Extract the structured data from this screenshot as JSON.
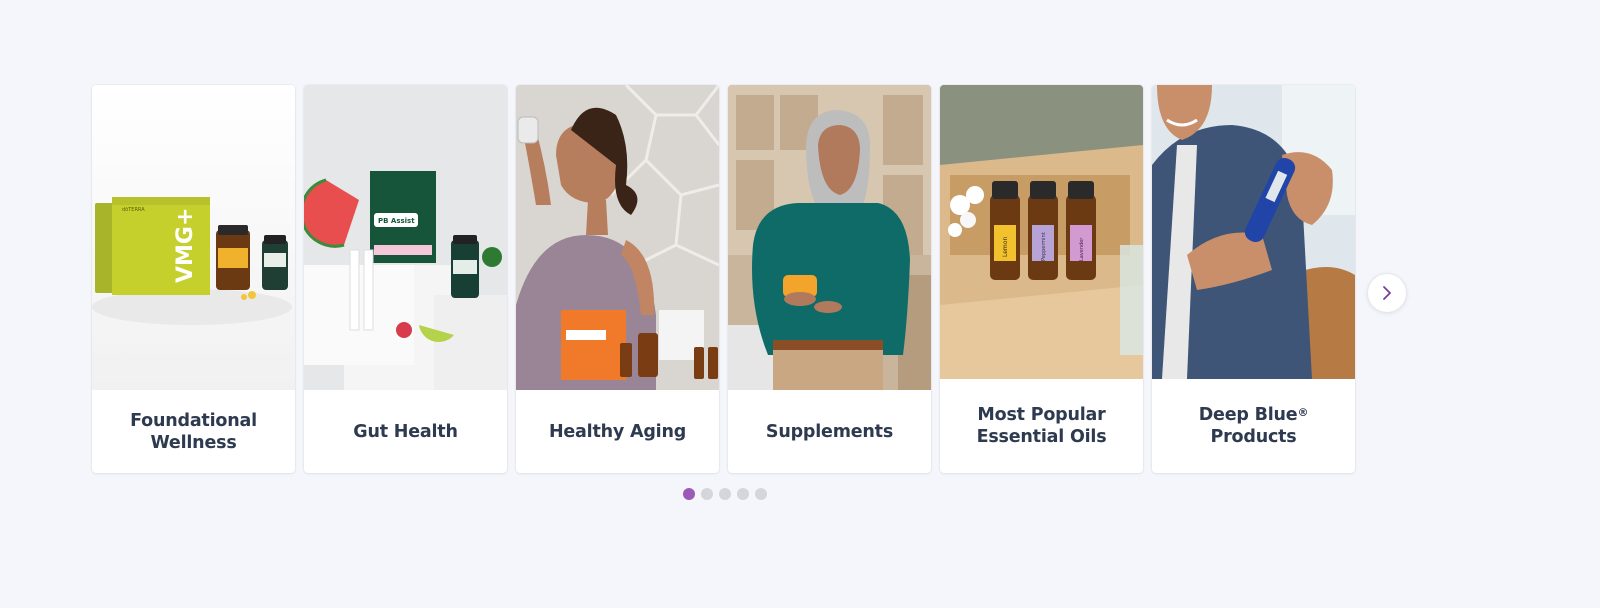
{
  "carousel": {
    "cards": [
      {
        "title": "Foundational Wellness",
        "image": "vmg-plus-product-kit-photo"
      },
      {
        "title": "Gut Health",
        "image": "pb-assist-products-photo"
      },
      {
        "title": "Healthy Aging",
        "image": "woman-drinking-metapwr-photo"
      },
      {
        "title": "Supplements",
        "image": "woman-holding-supplement-bottle-photo"
      },
      {
        "title": "Most Popular Essential Oils",
        "image": "essential-oil-bottles-tray-photo"
      },
      {
        "title": "Deep Blue",
        "title_mark": "®",
        "title_line2": "Products",
        "image": "man-holding-deep-blue-stick-photo"
      }
    ],
    "pagination": {
      "total": 5,
      "active_index": 0
    },
    "next_icon": "chevron-right-icon",
    "accent_color": "#9c59b6",
    "title_color": "#2e3a4f"
  },
  "image_text": {
    "vmg_brand": "dōTERRA",
    "vmg_product": "VMG+",
    "pb_label": "PB Assist",
    "oil_1": "Lemon",
    "oil_2": "Peppermint",
    "oil_3": "Lavender"
  }
}
